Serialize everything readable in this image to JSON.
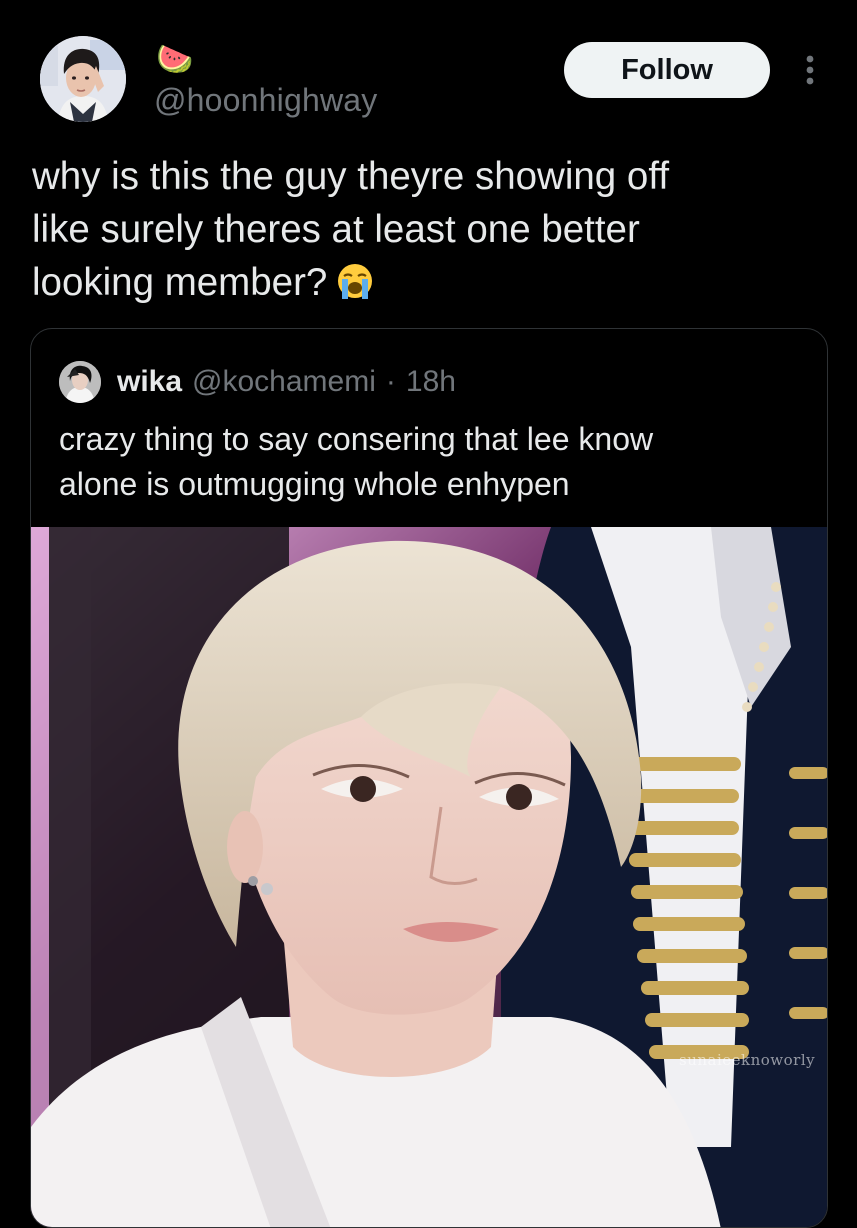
{
  "tweet": {
    "display_name_emoji": "🍉",
    "handle": "@hoonhighway",
    "follow_label": "Follow",
    "text_lines": [
      "why is this the guy theyre showing off",
      "like surely theres at least one better",
      "looking member?"
    ],
    "text_emoji": "😭"
  },
  "quote": {
    "name": "wika",
    "handle": "@kochamemi",
    "separator": "·",
    "time": "18h",
    "text_lines": [
      "crazy thing to say consering that lee know",
      "alone is outmugging whole enhypen"
    ],
    "media_watermark": "sunaieeknoworly"
  },
  "colors": {
    "background": "#000000",
    "text_primary": "#e7e9ea",
    "text_secondary": "#71767b",
    "border": "#2f3336",
    "follow_bg": "#eff3f4"
  },
  "icons": {
    "more": "more-dots-icon",
    "watermelon": "watermelon-emoji",
    "crying": "loudly-crying-emoji"
  }
}
